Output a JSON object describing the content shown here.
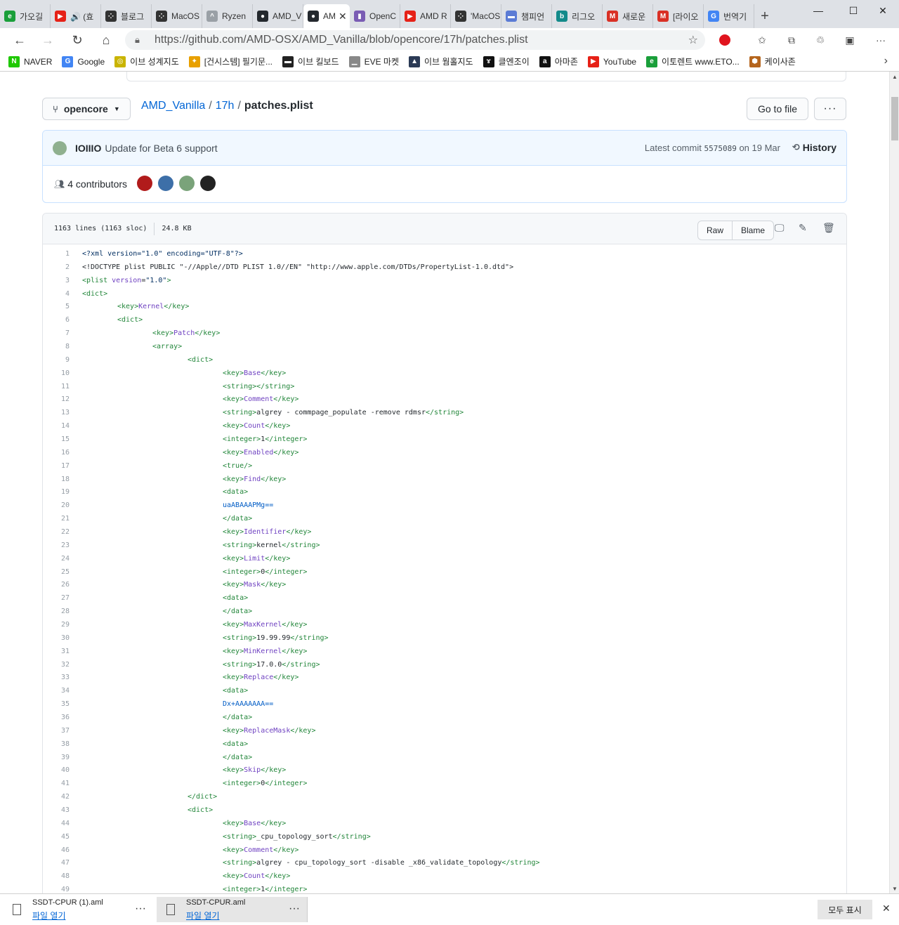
{
  "browser": {
    "tabs": [
      {
        "label": "가오길",
        "color": "#1a9f3a",
        "glyph": "e"
      },
      {
        "label": "🔊 (효",
        "color": "#e62117",
        "glyph": "▶"
      },
      {
        "label": "블로그",
        "color": "#333333",
        "glyph": "⁘"
      },
      {
        "label": "MacOS",
        "color": "#333333",
        "glyph": "⁘"
      },
      {
        "label": "Ryzen",
        "color": "#9aa0a6",
        "glyph": "^"
      },
      {
        "label": "AMD_V",
        "color": "#24292e",
        "glyph": "●"
      },
      {
        "label": "AM",
        "color": "#24292e",
        "glyph": "●",
        "active": true
      },
      {
        "label": "OpenC",
        "color": "#7a5cb4",
        "glyph": "▮"
      },
      {
        "label": "AMD R",
        "color": "#e62117",
        "glyph": "▶"
      },
      {
        "label": "'MacOS",
        "color": "#333333",
        "glyph": "⁘"
      },
      {
        "label": "챔피언",
        "color": "#5b7bd5",
        "glyph": "▬"
      },
      {
        "label": "리그오",
        "color": "#138a8a",
        "glyph": "b"
      },
      {
        "label": "새로운",
        "color": "#d93025",
        "glyph": "M"
      },
      {
        "label": "[라이오",
        "color": "#d93025",
        "glyph": "M"
      },
      {
        "label": "번역기",
        "color": "#4285f4",
        "glyph": "G"
      }
    ],
    "url": "https://github.com/AMD-OSX/AMD_Vanilla/blob/opencore/17h/patches.plist",
    "bookmarks": [
      {
        "label": "NAVER",
        "color": "#1ec800",
        "glyph": "N"
      },
      {
        "label": "Google",
        "color": "#4285f4",
        "glyph": "G"
      },
      {
        "label": "이브 성계지도",
        "color": "#c9b400",
        "glyph": "◎"
      },
      {
        "label": "[건시스템] 필기문...",
        "color": "#e8a000",
        "glyph": "✦"
      },
      {
        "label": "이브 킬보드",
        "color": "#222222",
        "glyph": "▬"
      },
      {
        "label": "EVE 마켓",
        "color": "#888888",
        "glyph": "▁"
      },
      {
        "label": "이브 웜홀지도",
        "color": "#2b3a55",
        "glyph": "▲"
      },
      {
        "label": "클엔조이",
        "color": "#111111",
        "glyph": "ɤ"
      },
      {
        "label": "아마존",
        "color": "#111111",
        "glyph": "a"
      },
      {
        "label": "YouTube",
        "color": "#e62117",
        "glyph": "▶"
      },
      {
        "label": "이토렌트 www.ETO...",
        "color": "#1a9f3a",
        "glyph": "e"
      },
      {
        "label": "케이사존",
        "color": "#b5651d",
        "glyph": "⬢"
      }
    ]
  },
  "repo": {
    "branch": "opencore",
    "path": [
      "AMD_Vanilla",
      "17h"
    ],
    "file": "patches.plist",
    "go_to_file": "Go to file",
    "more": "···"
  },
  "commit": {
    "author": "IOIIIO",
    "message": "Update for Beta 6 support",
    "latest_prefix": "Latest commit",
    "sha": "5575089",
    "date": "on 19 Mar",
    "history": "History",
    "contributors": "4 contributors",
    "avatar_colors": [
      "#b11b1b",
      "#3d6fa8",
      "#7aa37a",
      "#222222"
    ]
  },
  "file": {
    "lines": "1163 lines (1163 sloc)",
    "size": "24.8 KB",
    "raw": "Raw",
    "blame": "Blame",
    "code": [
      [
        0,
        [
          [
            "st",
            "<?xml version=\"1.0\" encoding=\"UTF-8\"?>"
          ]
        ]
      ],
      [
        0,
        [
          [
            "kt",
            "<!DOCTYPE plist PUBLIC \"-//Apple//DTD PLIST 1.0//EN\" \"http://www.apple.com/DTDs/PropertyList-1.0.dtd\">"
          ]
        ]
      ],
      [
        0,
        [
          [
            "tg",
            "<plist "
          ],
          [
            "at",
            "version"
          ],
          [
            "kt",
            "="
          ],
          [
            "st",
            "\"1.0\""
          ],
          [
            "tg",
            ">"
          ]
        ]
      ],
      [
        0,
        [
          [
            "tg",
            "<dict>"
          ]
        ]
      ],
      [
        1,
        [
          [
            "tg",
            "<key>"
          ],
          [
            "kw",
            "Kernel"
          ],
          [
            "tg",
            "</key>"
          ]
        ]
      ],
      [
        1,
        [
          [
            "tg",
            "<dict>"
          ]
        ]
      ],
      [
        2,
        [
          [
            "tg",
            "<key>"
          ],
          [
            "kw",
            "Patch"
          ],
          [
            "tg",
            "</key>"
          ]
        ]
      ],
      [
        2,
        [
          [
            "tg",
            "<array>"
          ]
        ]
      ],
      [
        3,
        [
          [
            "tg",
            "<dict>"
          ]
        ]
      ],
      [
        4,
        [
          [
            "tg",
            "<key>"
          ],
          [
            "kw",
            "Base"
          ],
          [
            "tg",
            "</key>"
          ]
        ]
      ],
      [
        4,
        [
          [
            "tg",
            "<string></string>"
          ]
        ]
      ],
      [
        4,
        [
          [
            "tg",
            "<key>"
          ],
          [
            "kw",
            "Comment"
          ],
          [
            "tg",
            "</key>"
          ]
        ]
      ],
      [
        4,
        [
          [
            "tg",
            "<string>"
          ],
          [
            "kt",
            "algrey - commpage_populate -remove rdmsr"
          ],
          [
            "tg",
            "</string>"
          ]
        ]
      ],
      [
        4,
        [
          [
            "tg",
            "<key>"
          ],
          [
            "kw",
            "Count"
          ],
          [
            "tg",
            "</key>"
          ]
        ]
      ],
      [
        4,
        [
          [
            "tg",
            "<integer>"
          ],
          [
            "kt",
            "1"
          ],
          [
            "tg",
            "</integer>"
          ]
        ]
      ],
      [
        4,
        [
          [
            "tg",
            "<key>"
          ],
          [
            "kw",
            "Enabled"
          ],
          [
            "tg",
            "</key>"
          ]
        ]
      ],
      [
        4,
        [
          [
            "tg",
            "<true/>"
          ]
        ]
      ],
      [
        4,
        [
          [
            "tg",
            "<key>"
          ],
          [
            "kw",
            "Find"
          ],
          [
            "tg",
            "</key>"
          ]
        ]
      ],
      [
        4,
        [
          [
            "tg",
            "<data>"
          ]
        ]
      ],
      [
        4,
        [
          [
            "vl",
            "uaABAAAPMg=="
          ]
        ]
      ],
      [
        4,
        [
          [
            "tg",
            "</data>"
          ]
        ]
      ],
      [
        4,
        [
          [
            "tg",
            "<key>"
          ],
          [
            "kw",
            "Identifier"
          ],
          [
            "tg",
            "</key>"
          ]
        ]
      ],
      [
        4,
        [
          [
            "tg",
            "<string>"
          ],
          [
            "kt",
            "kernel"
          ],
          [
            "tg",
            "</string>"
          ]
        ]
      ],
      [
        4,
        [
          [
            "tg",
            "<key>"
          ],
          [
            "kw",
            "Limit"
          ],
          [
            "tg",
            "</key>"
          ]
        ]
      ],
      [
        4,
        [
          [
            "tg",
            "<integer>"
          ],
          [
            "kt",
            "0"
          ],
          [
            "tg",
            "</integer>"
          ]
        ]
      ],
      [
        4,
        [
          [
            "tg",
            "<key>"
          ],
          [
            "kw",
            "Mask"
          ],
          [
            "tg",
            "</key>"
          ]
        ]
      ],
      [
        4,
        [
          [
            "tg",
            "<data>"
          ]
        ]
      ],
      [
        4,
        [
          [
            "tg",
            "</data>"
          ]
        ]
      ],
      [
        4,
        [
          [
            "tg",
            "<key>"
          ],
          [
            "kw",
            "MaxKernel"
          ],
          [
            "tg",
            "</key>"
          ]
        ]
      ],
      [
        4,
        [
          [
            "tg",
            "<string>"
          ],
          [
            "kt",
            "19.99.99"
          ],
          [
            "tg",
            "</string>"
          ]
        ]
      ],
      [
        4,
        [
          [
            "tg",
            "<key>"
          ],
          [
            "kw",
            "MinKernel"
          ],
          [
            "tg",
            "</key>"
          ]
        ]
      ],
      [
        4,
        [
          [
            "tg",
            "<string>"
          ],
          [
            "kt",
            "17.0.0"
          ],
          [
            "tg",
            "</string>"
          ]
        ]
      ],
      [
        4,
        [
          [
            "tg",
            "<key>"
          ],
          [
            "kw",
            "Replace"
          ],
          [
            "tg",
            "</key>"
          ]
        ]
      ],
      [
        4,
        [
          [
            "tg",
            "<data>"
          ]
        ]
      ],
      [
        4,
        [
          [
            "vl",
            "Dx+AAAAAAA=="
          ]
        ]
      ],
      [
        4,
        [
          [
            "tg",
            "</data>"
          ]
        ]
      ],
      [
        4,
        [
          [
            "tg",
            "<key>"
          ],
          [
            "kw",
            "ReplaceMask"
          ],
          [
            "tg",
            "</key>"
          ]
        ]
      ],
      [
        4,
        [
          [
            "tg",
            "<data>"
          ]
        ]
      ],
      [
        4,
        [
          [
            "tg",
            "</data>"
          ]
        ]
      ],
      [
        4,
        [
          [
            "tg",
            "<key>"
          ],
          [
            "kw",
            "Skip"
          ],
          [
            "tg",
            "</key>"
          ]
        ]
      ],
      [
        4,
        [
          [
            "tg",
            "<integer>"
          ],
          [
            "kt",
            "0"
          ],
          [
            "tg",
            "</integer>"
          ]
        ]
      ],
      [
        3,
        [
          [
            "tg",
            "</dict>"
          ]
        ]
      ],
      [
        3,
        [
          [
            "tg",
            "<dict>"
          ]
        ]
      ],
      [
        4,
        [
          [
            "tg",
            "<key>"
          ],
          [
            "kw",
            "Base"
          ],
          [
            "tg",
            "</key>"
          ]
        ]
      ],
      [
        4,
        [
          [
            "tg",
            "<string>"
          ],
          [
            "kt",
            "_cpu_topology_sort"
          ],
          [
            "tg",
            "</string>"
          ]
        ]
      ],
      [
        4,
        [
          [
            "tg",
            "<key>"
          ],
          [
            "kw",
            "Comment"
          ],
          [
            "tg",
            "</key>"
          ]
        ]
      ],
      [
        4,
        [
          [
            "tg",
            "<string>"
          ],
          [
            "kt",
            "algrey - cpu_topology_sort -disable _x86_validate_topology"
          ],
          [
            "tg",
            "</string>"
          ]
        ]
      ],
      [
        4,
        [
          [
            "tg",
            "<key>"
          ],
          [
            "kw",
            "Count"
          ],
          [
            "tg",
            "</key>"
          ]
        ]
      ],
      [
        4,
        [
          [
            "tg",
            "<integer>"
          ],
          [
            "kt",
            "1"
          ],
          [
            "tg",
            "</integer>"
          ]
        ]
      ]
    ]
  },
  "downloads": {
    "items": [
      {
        "name": "SSDT-CPUR (1).aml",
        "action": "파일 열기"
      },
      {
        "name": "SSDT-CPUR.aml",
        "action": "파일 열기"
      }
    ],
    "show_all": "모두 표시"
  }
}
